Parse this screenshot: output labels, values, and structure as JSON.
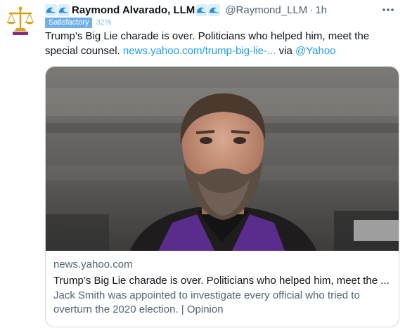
{
  "tweet": {
    "display_name": "Raymond Alvarado, LLM",
    "handle": "@Raymond_LLM",
    "separator": "·",
    "time": "1h",
    "badge": "Satisfactory",
    "badge_percent": "32%",
    "text_main": "Trump’s Big Lie charade is over. Politicians who helped him, meet the special counsel. ",
    "text_link": "news.yahoo.com/trump-big-lie-...",
    "text_via": " via ",
    "text_mention": "@Yahoo",
    "icons": {
      "avatar": "scales-of-justice-logo",
      "name_emoji": "water-wave-icon",
      "more": "more-dots-icon"
    }
  },
  "card": {
    "domain": "news.yahoo.com",
    "title": "Trump’s Big Lie charade is over. Politicians who helped him, meet the ...",
    "description": "Jack Smith was appointed to investigate every official who tried to overturn the 2020 election. | Opinion",
    "image": "photo-of-bearded-man-in-purple-robe"
  },
  "colors": {
    "link": "#1d9bf0",
    "secondary_text": "#536471",
    "badge_bg": "#6fb1e6",
    "card_border": "#cfd9de"
  }
}
